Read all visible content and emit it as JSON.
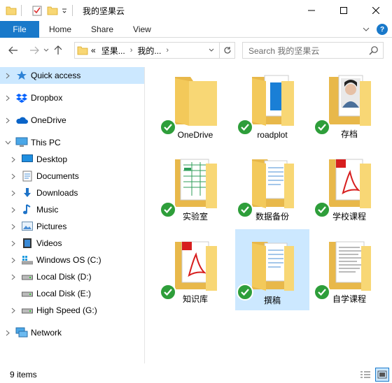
{
  "window": {
    "title": "我的坚果云"
  },
  "ribbon": {
    "file": "File",
    "tabs": [
      "Home",
      "Share",
      "View"
    ]
  },
  "nav": {
    "crumbs": [
      "«",
      "坚果...",
      "我的..."
    ],
    "search_placeholder": "Search 我的坚果云"
  },
  "sidebar": {
    "items": [
      {
        "label": "Quick access",
        "icon": "star-icon"
      },
      {
        "label": "Dropbox",
        "icon": "dropbox-icon"
      },
      {
        "label": "OneDrive",
        "icon": "cloud-icon"
      },
      {
        "label": "This PC",
        "icon": "computer-icon"
      },
      {
        "label": "Desktop",
        "icon": "desktop-icon"
      },
      {
        "label": "Documents",
        "icon": "documents-icon"
      },
      {
        "label": "Downloads",
        "icon": "download-icon"
      },
      {
        "label": "Music",
        "icon": "music-icon"
      },
      {
        "label": "Pictures",
        "icon": "pictures-icon"
      },
      {
        "label": "Videos",
        "icon": "videos-icon"
      },
      {
        "label": "Windows OS (C:)",
        "icon": "windows-drive-icon"
      },
      {
        "label": "Local Disk (D:)",
        "icon": "drive-icon"
      },
      {
        "label": "Local Disk (E:)",
        "icon": "drive-icon"
      },
      {
        "label": "High Speed (G:)",
        "icon": "drive-icon"
      },
      {
        "label": "Network",
        "icon": "network-icon"
      }
    ]
  },
  "folders": [
    {
      "name": "OneDrive",
      "kind": "plain"
    },
    {
      "name": "roadplot",
      "kind": "doc"
    },
    {
      "name": "存档",
      "kind": "photo"
    },
    {
      "name": "实验室",
      "kind": "sheet"
    },
    {
      "name": "数据备份",
      "kind": "doc"
    },
    {
      "name": "学校课程",
      "kind": "pdf"
    },
    {
      "name": "知识库",
      "kind": "pdf"
    },
    {
      "name": "撰稿",
      "kind": "doc"
    },
    {
      "name": "自学课程",
      "kind": "text"
    }
  ],
  "status": {
    "count": "9 items"
  },
  "colors": {
    "accent": "#1979ca",
    "selection": "#cce8ff",
    "sync_ok": "#2e9e3a",
    "folder": "#f8d775"
  }
}
